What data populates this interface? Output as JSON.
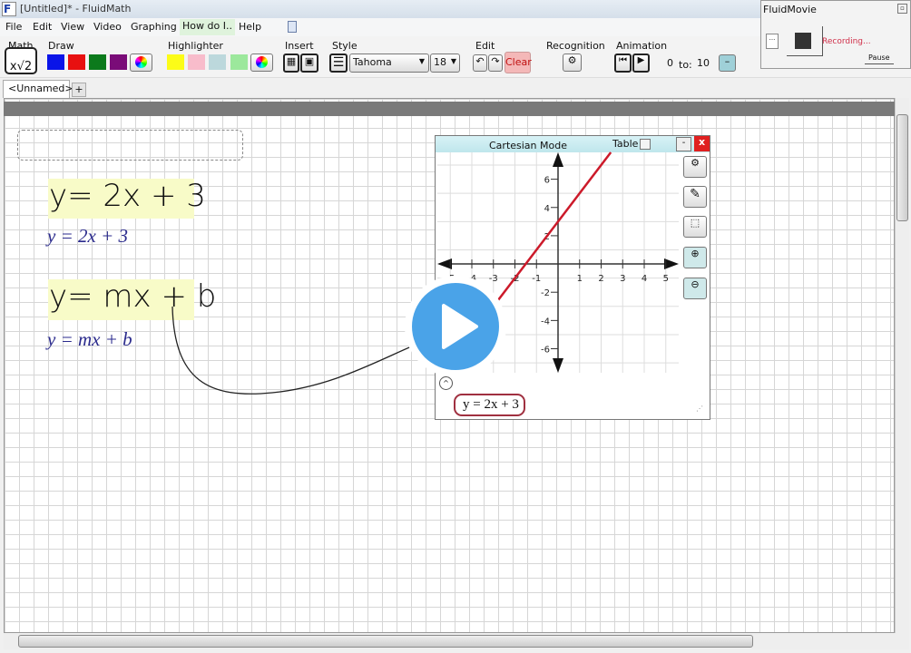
{
  "window": {
    "title": "[Untitled]* - FluidMath",
    "icon_letter": "F"
  },
  "menu": [
    "File",
    "Edit",
    "View",
    "Video",
    "Graphing",
    "How do I..",
    "Help"
  ],
  "toolbar": {
    "math_label": "Math",
    "draw_label": "Draw",
    "highlighter_label": "Highlighter",
    "insert_label": "Insert",
    "style_label": "Style",
    "font": "Tahoma",
    "font_size": "18",
    "edit_label": "Edit",
    "clear_label": "Clear",
    "recognition_label": "Recognition",
    "animation_label": "Animation",
    "anim_from": "0",
    "anim_to_label": "to:",
    "anim_to": "10",
    "draw_colors": [
      "#0a14e8",
      "#e81010",
      "#0c7a1c",
      "#7a0c78"
    ],
    "highlighter_colors": [
      "#fcfc18",
      "#f8bccb",
      "#bcd8dc",
      "#9ce89c"
    ]
  },
  "tabs": {
    "active": "<Unnamed>",
    "add": "+"
  },
  "canvas": {
    "equations": [
      {
        "handwritten": "y= 2x + 3",
        "typed": "y = 2x + 3"
      },
      {
        "handwritten": "y= mx + b",
        "typed": "y = mx + b"
      }
    ],
    "highlight_color": "#f8fbc8"
  },
  "graph": {
    "title": "Cartesian Mode",
    "table_label": "Table",
    "close_label": "x",
    "minimize_label": "-",
    "equation_label": "y = 2x + 3",
    "chart_data": {
      "type": "line",
      "xlim": [
        -5.6,
        5.6
      ],
      "ylim": [
        -7.7,
        7.9
      ],
      "x_ticks": [
        -5,
        -4,
        -3,
        -2,
        -1,
        1,
        2,
        3,
        4,
        5
      ],
      "y_ticks": [
        -6,
        -4,
        -2,
        2,
        4,
        6
      ],
      "series": [
        {
          "equation": "y = 2x + 3",
          "slope": 2,
          "intercept": 3,
          "color": "#cc1a2a"
        }
      ],
      "grid": true
    }
  },
  "movie": {
    "title": "FluidMovie",
    "status": "Recording...",
    "pause_label": "Pause",
    "small_btn": "..."
  }
}
